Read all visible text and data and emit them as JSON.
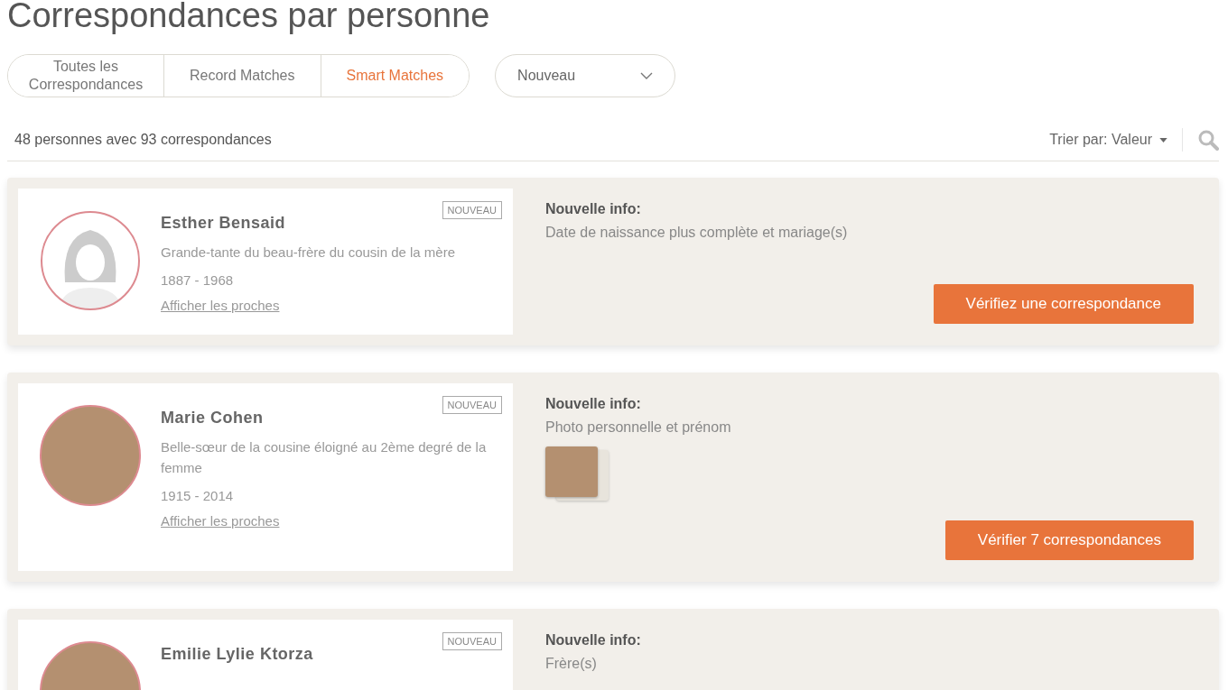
{
  "page_title": "Correspondances par personne",
  "tabs": [
    {
      "label": "Toutes les Correspondances",
      "selected": false
    },
    {
      "label": "Record Matches",
      "selected": false
    },
    {
      "label": "Smart Matches",
      "selected": true
    }
  ],
  "filter": {
    "value": "Nouveau"
  },
  "summary": "48 personnes avec 93 correspondances",
  "sort": {
    "label": "Trier par: Valeur"
  },
  "matches": [
    {
      "name": "Esther Bensaid",
      "badge": "NOUVEAU",
      "kind": "silhouette",
      "relation": "Grande-tante du beau-frère du cousin de la mère",
      "dates": "1887 - 1968",
      "link": "Afficher les proches",
      "info_title": "Nouvelle info:",
      "info": "Date de naissance plus complète et mariage(s)",
      "thumbnail": false,
      "button": "Vérifiez une correspondance"
    },
    {
      "name": "Marie Cohen",
      "badge": "NOUVEAU",
      "kind": "photo",
      "relation": "Belle-sœur de la cousine éloigné au 2ème degré de la femme",
      "dates": "1915 - 2014",
      "link": "Afficher les proches",
      "info_title": "Nouvelle info:",
      "info": "Photo personnelle et prénom",
      "thumbnail": true,
      "button": "Vérifier 7 correspondances"
    },
    {
      "name": "Emilie Lylie Ktorza",
      "badge": "NOUVEAU",
      "kind": "photo",
      "info_title": "Nouvelle info:",
      "info": "Frère(s)",
      "thumbnail": false
    }
  ]
}
